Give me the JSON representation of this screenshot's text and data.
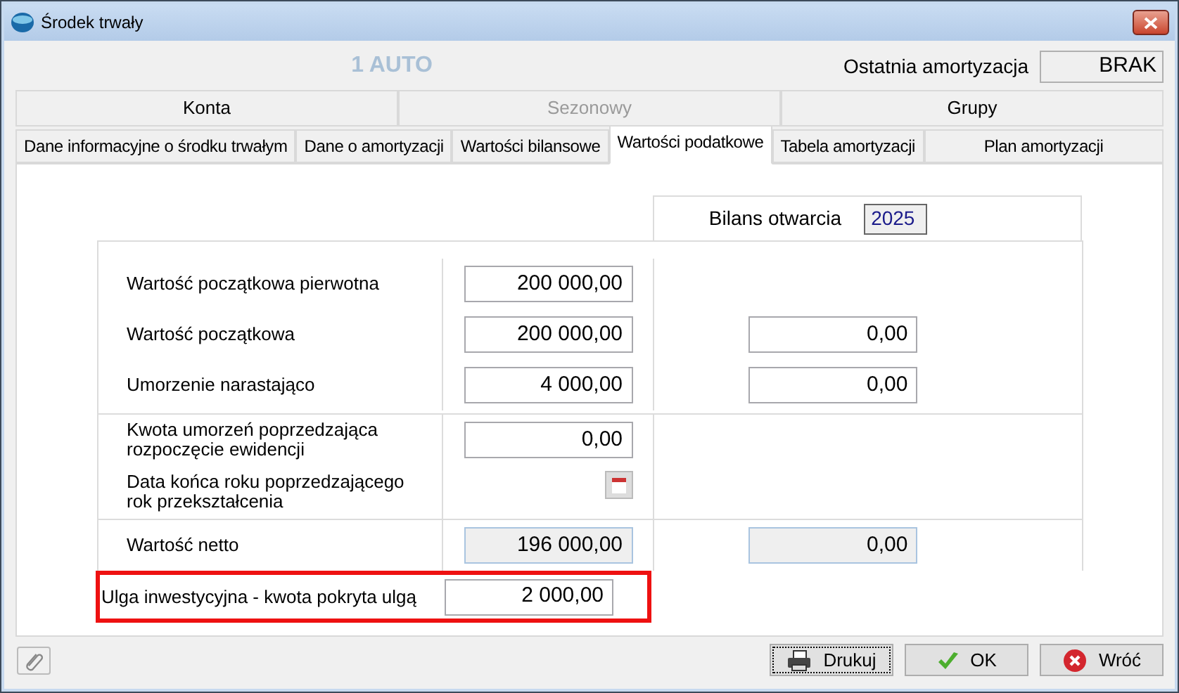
{
  "window": {
    "title": "Środek trwały"
  },
  "header": {
    "asset_name": "1 AUTO",
    "last_label": "Ostatnia amortyzacja",
    "last_value": "BRAK"
  },
  "tabs_top": [
    {
      "label": "Konta",
      "disabled": false
    },
    {
      "label": "Sezonowy",
      "disabled": true
    },
    {
      "label": "Grupy",
      "disabled": false
    }
  ],
  "tabs": [
    {
      "label": "Dane informacyjne o środku trwałym",
      "selected": false
    },
    {
      "label": "Dane o amortyzacji",
      "selected": false
    },
    {
      "label": "Wartości bilansowe",
      "selected": false
    },
    {
      "label": "Wartości podatkowe",
      "selected": true
    },
    {
      "label": "Tabela amortyzacji",
      "selected": false
    },
    {
      "label": "Plan amortyzacji",
      "selected": false
    }
  ],
  "opening_balance": {
    "label": "Bilans otwarcia",
    "year": "2025"
  },
  "sections": [
    [
      {
        "kind": "field",
        "label": "Wartość początkowa pierwotna",
        "value": "200 000,00"
      },
      {
        "kind": "field",
        "label": "Wartość początkowa",
        "value": "200 000,00",
        "right_value": "0,00"
      },
      {
        "kind": "field",
        "label": "Umorzenie narastająco",
        "value": "4 000,00",
        "right_value": "0,00"
      }
    ],
    [
      {
        "kind": "field",
        "label": "Kwota umorzeń poprzedzająca rozpoczęcie ewidencji",
        "value": "0,00"
      },
      {
        "kind": "date",
        "label": "Data końca roku poprzedzającego rok przekształcenia"
      }
    ],
    [
      {
        "kind": "readonly",
        "label": "Wartość netto",
        "value": "196 000,00",
        "right_value": "0,00"
      }
    ]
  ],
  "relief": {
    "label": "Ulga inwestycyjna - kwota pokryta ulgą",
    "value": "2 000,00",
    "highlighted": true
  },
  "buttons": [
    {
      "kind": "print",
      "label": "Drukuj",
      "focused": true
    },
    {
      "kind": "ok",
      "label": "OK",
      "focused": false
    },
    {
      "kind": "back",
      "label": "Wróć",
      "focused": false
    }
  ]
}
